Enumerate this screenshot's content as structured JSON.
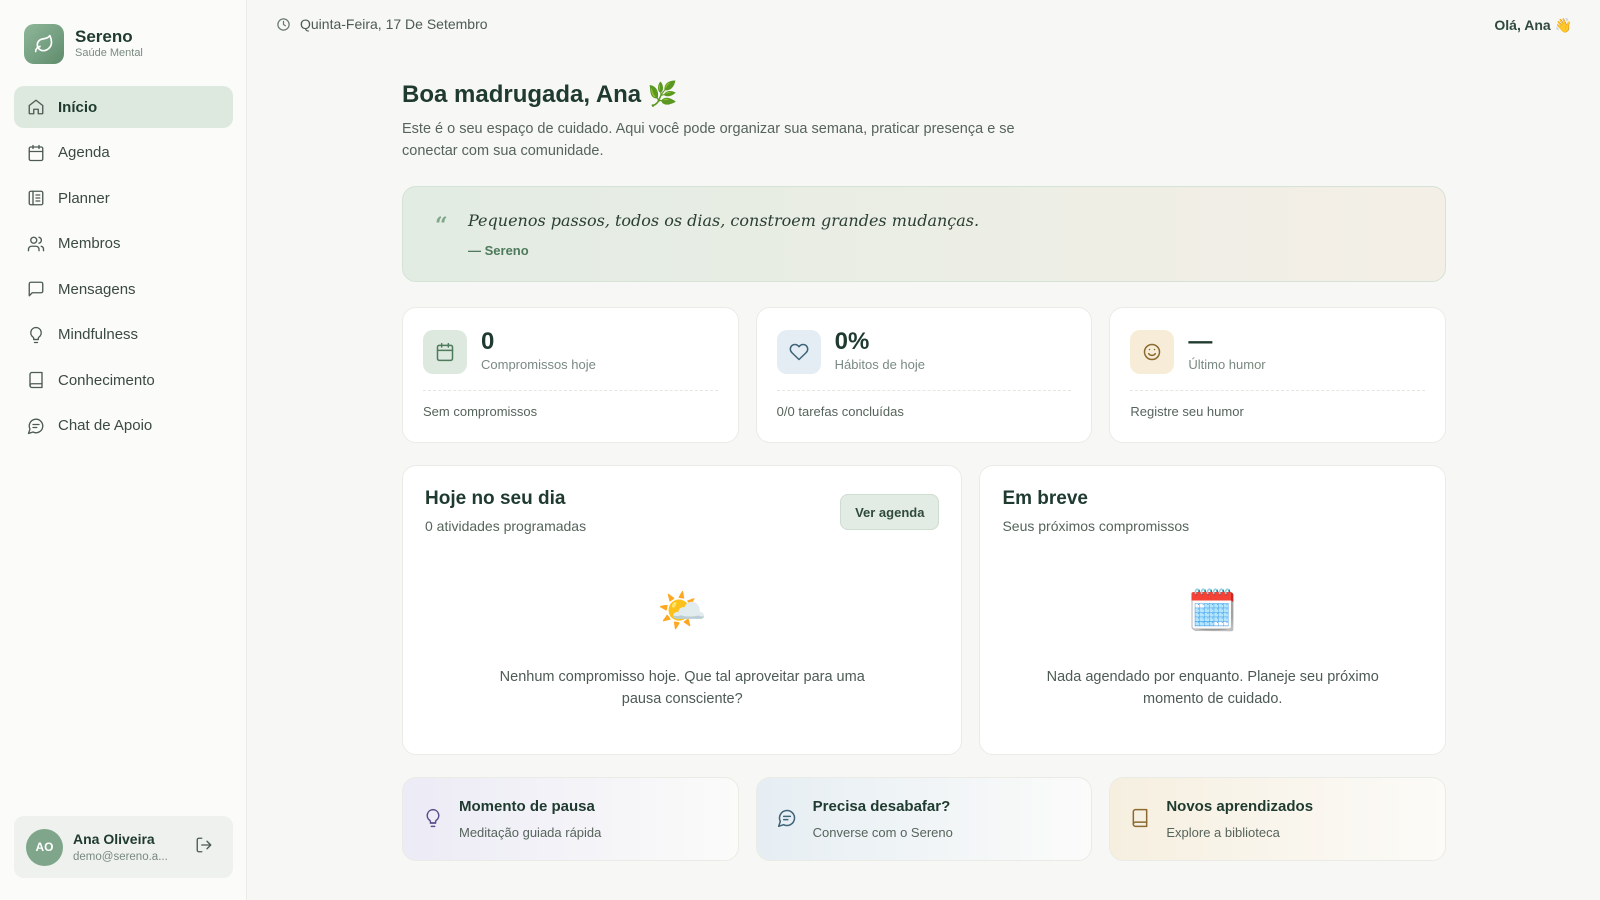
{
  "brand": {
    "name": "Sereno",
    "subtitle": "Saúde Mental"
  },
  "nav": {
    "items": [
      {
        "label": "Início",
        "icon": "home-icon",
        "active": true
      },
      {
        "label": "Agenda",
        "icon": "calendar-icon"
      },
      {
        "label": "Planner",
        "icon": "planner-icon"
      },
      {
        "label": "Membros",
        "icon": "users-icon"
      },
      {
        "label": "Mensagens",
        "icon": "message-icon"
      },
      {
        "label": "Mindfulness",
        "icon": "lightbulb-icon"
      },
      {
        "label": "Conhecimento",
        "icon": "book-icon"
      },
      {
        "label": "Chat de Apoio",
        "icon": "chat-icon"
      }
    ]
  },
  "user": {
    "initials": "AO",
    "name": "Ana Oliveira",
    "email": "demo@sereno.a..."
  },
  "header": {
    "date": "Quinta-Feira, 17 De Setembro",
    "greeting": "Olá, Ana 👋"
  },
  "main": {
    "title": "Boa madrugada, Ana 🌿",
    "subtitle": "Este é o seu espaço de cuidado. Aqui você pode organizar sua semana, praticar presença e se conectar com sua comunidade."
  },
  "quote": {
    "text": "Pequenos passos, todos os dias, constroem grandes mudanças.",
    "author": "— Sereno"
  },
  "stats": [
    {
      "value": "0",
      "label": "Compromissos hoje",
      "footer": "Sem compromissos",
      "icon": "calendar-icon",
      "color": "#dde9df"
    },
    {
      "value": "0%",
      "label": "Hábitos de hoje",
      "footer": "0/0 tarefas concluídas",
      "icon": "heart-icon",
      "color": "#e3edf3"
    },
    {
      "value": "—",
      "label": "Último humor",
      "footer": "Registre seu humor",
      "icon": "smile-icon",
      "color": "#f6ecd8"
    }
  ],
  "today": {
    "title": "Hoje no seu dia",
    "subtitle": "0 atividades programadas",
    "button": "Ver agenda",
    "emoji": "🌤️",
    "empty": "Nenhum compromisso hoje. Que tal aproveitar para uma pausa consciente?"
  },
  "upcoming": {
    "title": "Em breve",
    "subtitle": "Seus próximos compromissos",
    "emoji": "🗓️",
    "empty": "Nada agendado por enquanto. Planeje seu próximo momento de cuidado."
  },
  "quick": [
    {
      "title": "Momento de pausa",
      "subtitle": "Meditação guiada rápida",
      "icon": "lightbulb-icon"
    },
    {
      "title": "Precisa desabafar?",
      "subtitle": "Converse com o Sereno",
      "icon": "chat-icon"
    },
    {
      "title": "Novos aprendizados",
      "subtitle": "Explore a biblioteca",
      "icon": "book-icon"
    }
  ]
}
